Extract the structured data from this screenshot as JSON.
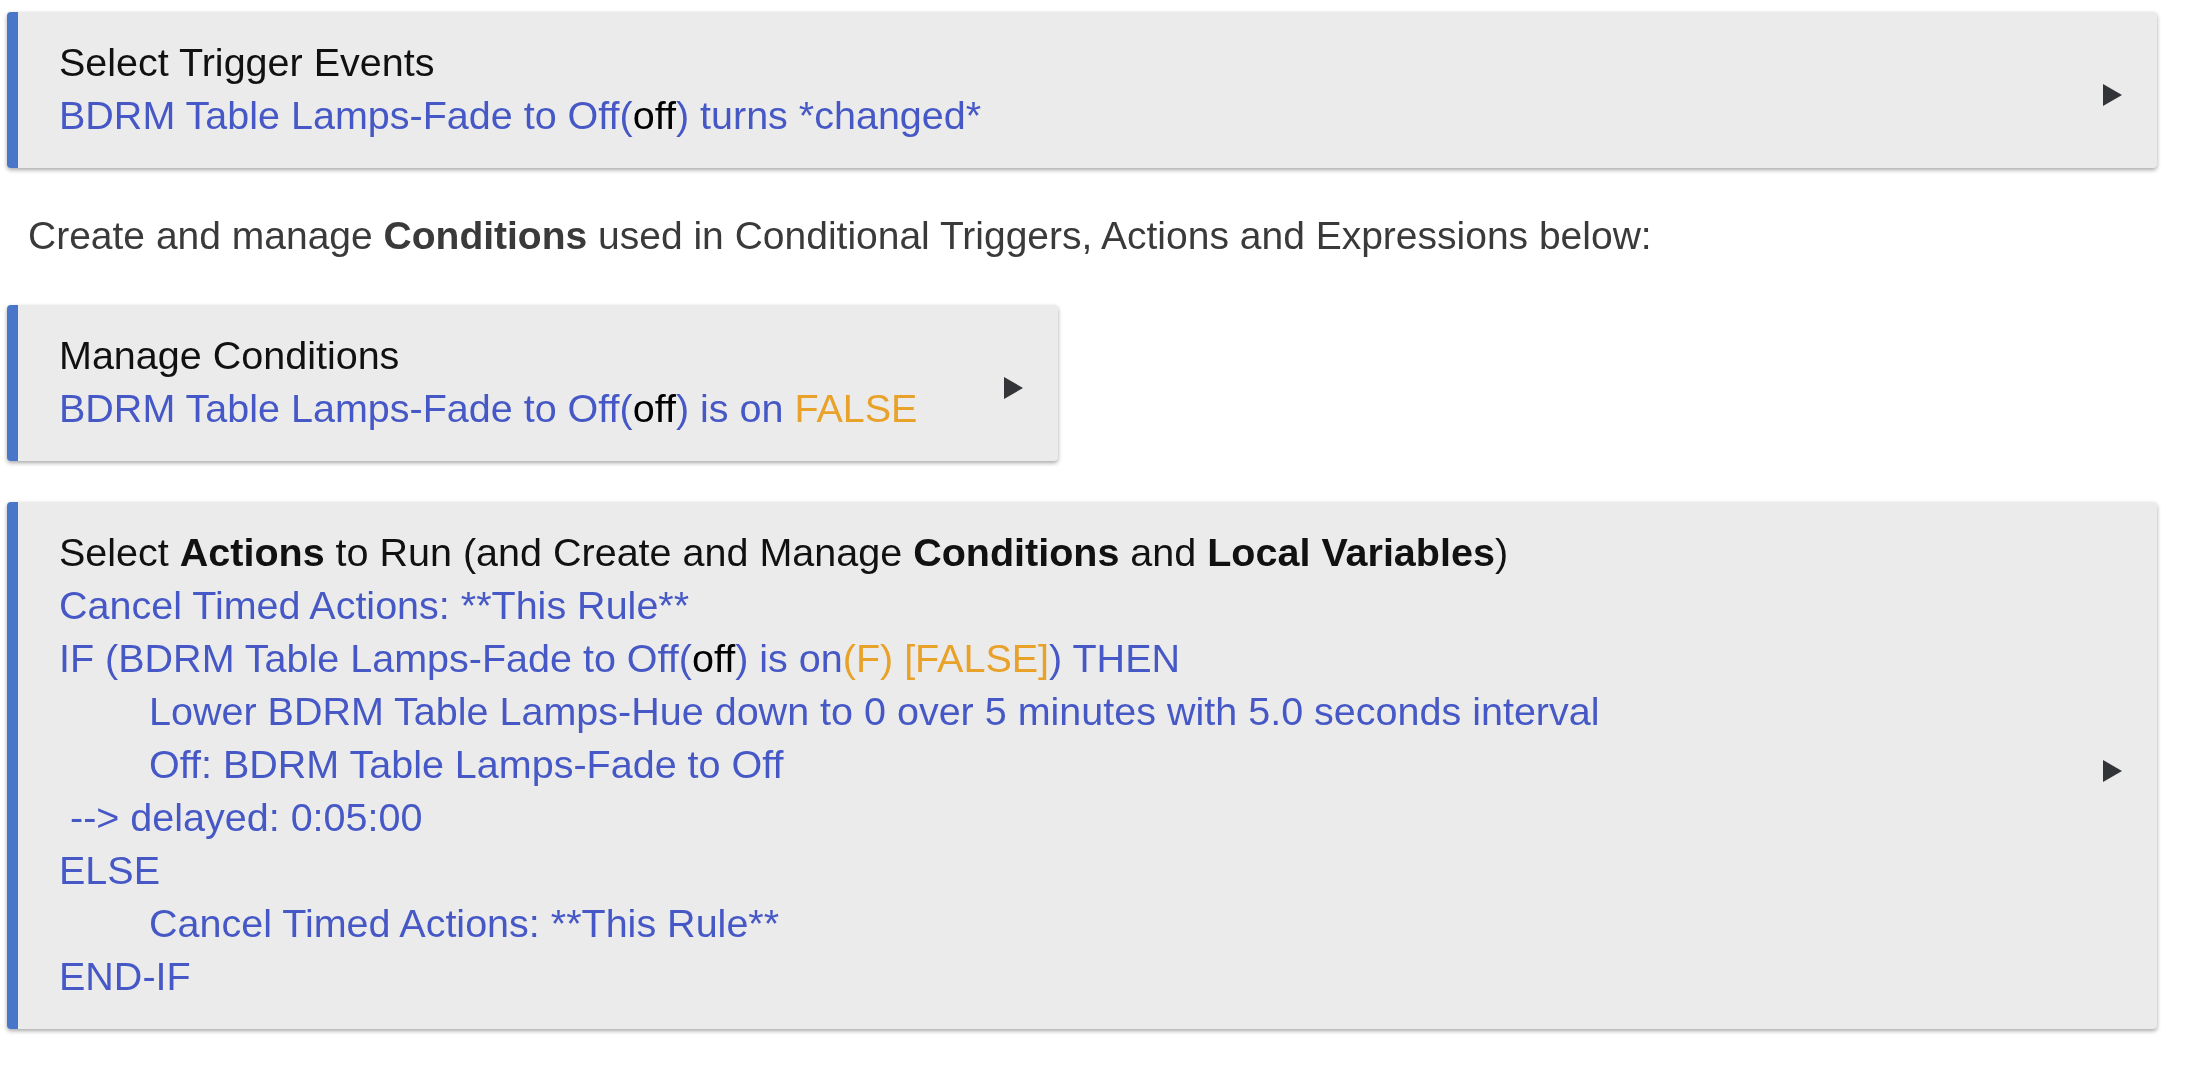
{
  "sections": [
    {
      "kind": "wide",
      "title": "Select Trigger Events",
      "lines": [
        {
          "segments": [
            {
              "kind": "link",
              "text": "BDRM Table Lamps-Fade to Off("
            },
            {
              "kind": "value",
              "text": "off"
            },
            {
              "kind": "link",
              "text": ") turns *changed*"
            }
          ]
        }
      ]
    },
    {
      "kind": "note",
      "text": "Create and manage **Conditions** used in Conditional Triggers, Actions and Expressions below:"
    },
    {
      "kind": "narrow",
      "title": "Manage Conditions",
      "lines": [
        {
          "segments": [
            {
              "kind": "link",
              "text": "BDRM Table Lamps-Fade to Off("
            },
            {
              "kind": "value",
              "text": "off"
            },
            {
              "kind": "link",
              "text": ") is on "
            },
            {
              "kind": "status",
              "text": "FALSE"
            }
          ]
        }
      ]
    },
    {
      "kind": "wide",
      "title": "Select **Actions** to Run (and Create and Manage **Conditions** and **Local Variables**)",
      "lines": [
        {
          "segments": [
            {
              "kind": "link",
              "text": "Cancel Timed Actions: **This Rule**"
            }
          ]
        },
        {
          "segments": [
            {
              "kind": "link",
              "text": "IF (BDRM Table Lamps-Fade to Off("
            },
            {
              "kind": "value",
              "text": "off"
            },
            {
              "kind": "link",
              "text": ") is on"
            },
            {
              "kind": "status",
              "text": "(F) [FALSE]"
            },
            {
              "kind": "link",
              "text": ") THEN"
            }
          ],
          "children": [
            {
              "segments": [
                {
                  "kind": "link",
                  "text": "Lower BDRM Table Lamps-Hue down to 0 over 5 minutes with 5.0 seconds interval"
                }
              ]
            },
            {
              "segments": [
                {
                  "kind": "link",
                  "text": "Off: BDRM Table Lamps-Fade to Off"
                }
              ]
            }
          ]
        },
        {
          "segments": [
            {
              "kind": "link",
              "text": " --> delayed: 0:05:00"
            }
          ]
        },
        {
          "segments": [
            {
              "kind": "link",
              "text": "ELSE"
            }
          ],
          "children": [
            {
              "segments": [
                {
                  "kind": "link",
                  "text": "Cancel Timed Actions: **This Rule**"
                }
              ]
            }
          ]
        },
        {
          "segments": [
            {
              "kind": "link",
              "text": "END-IF"
            }
          ]
        }
      ]
    }
  ]
}
